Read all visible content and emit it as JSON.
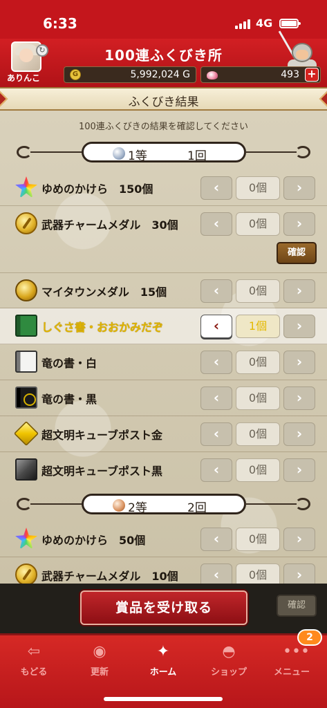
{
  "status_bar": {
    "time": "6:33",
    "network": "4G"
  },
  "header": {
    "username": "ありんこ",
    "title": "100連ふくびき所",
    "gold": "5,992,024 G",
    "gems": "493",
    "gem_add": "+",
    "coin_glyph": "G"
  },
  "section": {
    "title": "ふくびき結果",
    "instruction": "100連ふくびきの結果を確認してください"
  },
  "ranks": [
    {
      "name": "1等",
      "count": "1回"
    },
    {
      "name": "2等",
      "count": "2回"
    }
  ],
  "items": [
    {
      "name": "ゆめのかけら　150個",
      "qty": "0個",
      "icon": "rainbow-shard-icon"
    },
    {
      "name": "武器チャームメダル　30個",
      "qty": "0個",
      "icon": "gold-medal-icon"
    },
    {
      "name": "マイタウンメダル　15個",
      "qty": "0個",
      "icon": "town-medal-icon"
    },
    {
      "name": "しぐさ書・おおかみだぞ",
      "qty": "1個",
      "icon": "green-book-icon",
      "highlight": true
    },
    {
      "name": "竜の書・白",
      "qty": "0個",
      "icon": "white-book-icon"
    },
    {
      "name": "竜の書・黒",
      "qty": "0個",
      "icon": "black-book-icon"
    },
    {
      "name": "超文明キューブポスト金",
      "qty": "0個",
      "icon": "gold-cube-icon"
    },
    {
      "name": "超文明キューブポスト黒",
      "qty": "0個",
      "icon": "black-cube-icon"
    },
    {
      "name": "ゆめのかけら　50個",
      "qty": "0個",
      "icon": "rainbow-shard-icon"
    },
    {
      "name": "武器チャームメダル　10個",
      "qty": "0個",
      "icon": "gold-medal-icon"
    }
  ],
  "buttons": {
    "dec": "‹",
    "inc": "›",
    "confirm": "確認",
    "receive": "賞品を受け取る"
  },
  "tabs": [
    {
      "label": "もどる",
      "icon": "back-arrow-icon",
      "glyph": "⇦"
    },
    {
      "label": "更新",
      "icon": "refresh-flame-icon",
      "glyph": "◉"
    },
    {
      "label": "ホーム",
      "icon": "dracky-home-icon",
      "glyph": "✦"
    },
    {
      "label": "ショップ",
      "icon": "slime-shop-icon",
      "glyph": "◓"
    },
    {
      "label": "メニュー",
      "icon": "menu-dots-icon",
      "glyph": "•••"
    }
  ],
  "menu_badge": "2",
  "colors": {
    "primary_red": "#c4161c",
    "highlight_text": "#e0b400",
    "panel_bg": "#d7cfb8"
  }
}
